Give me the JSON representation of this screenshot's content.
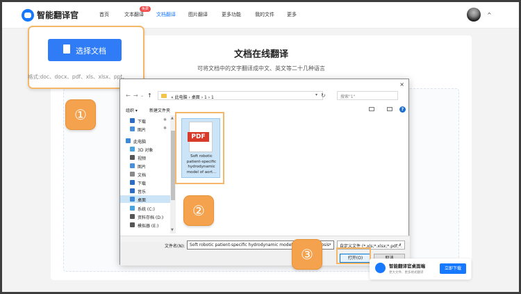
{
  "nav": {
    "brand": "智能翻译官",
    "items": [
      "首页",
      "文本翻译",
      "文档翻译",
      "图片翻译",
      "更多功能",
      "我的文件",
      "更多"
    ],
    "badge": "免费",
    "caret": "^"
  },
  "main": {
    "title": "文档在线翻译",
    "subtitle": "可将文档中的文字翻译成中文、英文等二十几种语言"
  },
  "upload": {
    "button": "选择文档",
    "formats": "格式:doc、docx、pdf、xls、xlsx、ppt、"
  },
  "steps": [
    "①",
    "②",
    "③"
  ],
  "dialog": {
    "close": "×",
    "breadcrumb": "« 此电脑 › 桌面 › 1 › 1",
    "search_placeholder": "搜索\"1\"",
    "organize": "组织 ▾",
    "new_folder": "新建文件夹",
    "help": "?",
    "sidebar": [
      {
        "label": "下载",
        "icon": "download-icon",
        "color": "#2b6cc4"
      },
      {
        "label": "图片",
        "icon": "pictures-icon",
        "color": "#4a8fd9"
      },
      {
        "label": "此电脑",
        "icon": "computer-icon",
        "color": "#3c8ad8"
      },
      {
        "label": "3D 对象",
        "icon": "3d-objects-icon",
        "color": "#4aa3df"
      },
      {
        "label": "视频",
        "icon": "video-icon",
        "color": "#555555"
      },
      {
        "label": "图片",
        "icon": "pictures-icon",
        "color": "#4a8fd9"
      },
      {
        "label": "文档",
        "icon": "documents-icon",
        "color": "#8a8a8a"
      },
      {
        "label": "下载",
        "icon": "download-icon",
        "color": "#2b6cc4"
      },
      {
        "label": "音乐",
        "icon": "music-icon",
        "color": "#2b6cc4"
      },
      {
        "label": "桌面",
        "icon": "desktop-icon",
        "color": "#3c8ad8"
      },
      {
        "label": "系统 (C:)",
        "icon": "drive-c-icon",
        "color": "#4aa3df"
      },
      {
        "label": "资料存档 (D:)",
        "icon": "drive-icon",
        "color": "#555555"
      },
      {
        "label": "模拟器 (E:)",
        "icon": "drive-icon",
        "color": "#555555"
      }
    ],
    "file": {
      "type_label": "PDF",
      "name": "Soft robotic patient-specific hydrodynamic model of aort..."
    },
    "filename_label": "文件名(N):",
    "filename_value": "Soft robotic patient-specific hydrodynamic model of aortic stenosis",
    "filetype_value": "自定义文件 (*.xls;*.xlsx;*.pdf;*.",
    "open_button": "打开(O)",
    "cancel_button": "取消"
  },
  "promo": {
    "title": "智能翻译官桌面端",
    "subtitle": "更大文件、更多格式翻译",
    "button": "立即下载"
  },
  "colors": {
    "accent": "#1677ff",
    "highlight": "#f7b769",
    "step_badge": "#f4a24e",
    "pdf_red": "#d93b2b"
  }
}
